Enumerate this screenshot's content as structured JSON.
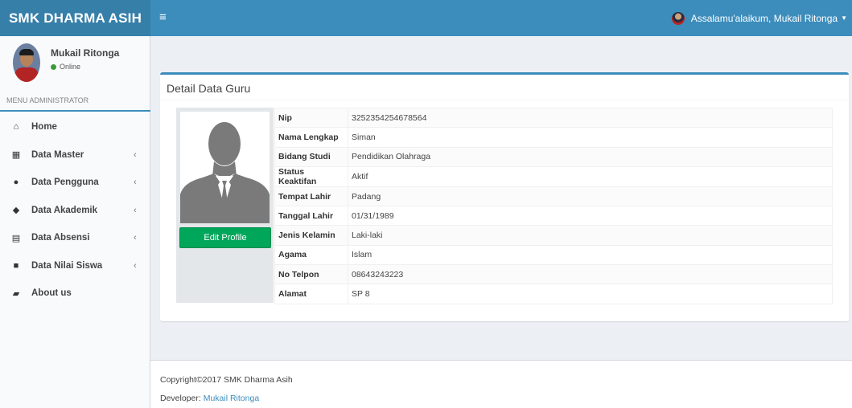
{
  "header": {
    "brand": "SMK DHARMA ASIH",
    "toggle_icon": "≡",
    "greeting": "Assalamu'alaikum, Mukail Ritonga",
    "caret": "▼"
  },
  "sidebar": {
    "user_name": "Mukail Ritonga",
    "user_status": "Online",
    "menu_header": "MENU ADMINISTRATOR",
    "items": [
      {
        "label": "Home",
        "icon": "home-icon",
        "glyph": "⌂",
        "chevron": ""
      },
      {
        "label": "Data Master",
        "icon": "table-icon",
        "glyph": "▦",
        "chevron": "‹"
      },
      {
        "label": "Data Pengguna",
        "icon": "user-icon",
        "glyph": "●",
        "chevron": "‹"
      },
      {
        "label": "Data Akademik",
        "icon": "tag-icon",
        "glyph": "◆",
        "chevron": "‹"
      },
      {
        "label": "Data Absensi",
        "icon": "calendar-icon",
        "glyph": "▤",
        "chevron": "‹"
      },
      {
        "label": "Data Nilai Siswa",
        "icon": "grid-icon",
        "glyph": "■",
        "chevron": "‹"
      },
      {
        "label": "About us",
        "icon": "book-icon",
        "glyph": "▰",
        "chevron": ""
      }
    ]
  },
  "main": {
    "title": "Detail Data Guru",
    "edit_button": "Edit Profile",
    "fields": [
      {
        "label": "Nip",
        "value": "3252354254678564"
      },
      {
        "label": "Nama Lengkap",
        "value": "Siman"
      },
      {
        "label": "Bidang Studi",
        "value": "Pendidikan Olahraga"
      },
      {
        "label": "Status Keaktifan",
        "value": "Aktif"
      },
      {
        "label": "Tempat Lahir",
        "value": "Padang"
      },
      {
        "label": "Tanggal Lahir",
        "value": "01/31/1989"
      },
      {
        "label": "Jenis Kelamin",
        "value": "Laki-laki"
      },
      {
        "label": "Agama",
        "value": "Islam"
      },
      {
        "label": "No Telpon",
        "value": "08643243223"
      },
      {
        "label": "Alamat",
        "value": "SP 8"
      }
    ]
  },
  "footer": {
    "copyright": "Copyright©2017 SMK Dharma Asih",
    "developer_label": "Developer: ",
    "developer_name": "Mukail Ritonga"
  },
  "colors": {
    "header": "#3c8dbc",
    "brand_bg": "#367fa9",
    "button": "#00a65a",
    "link": "#3c8dbc"
  }
}
